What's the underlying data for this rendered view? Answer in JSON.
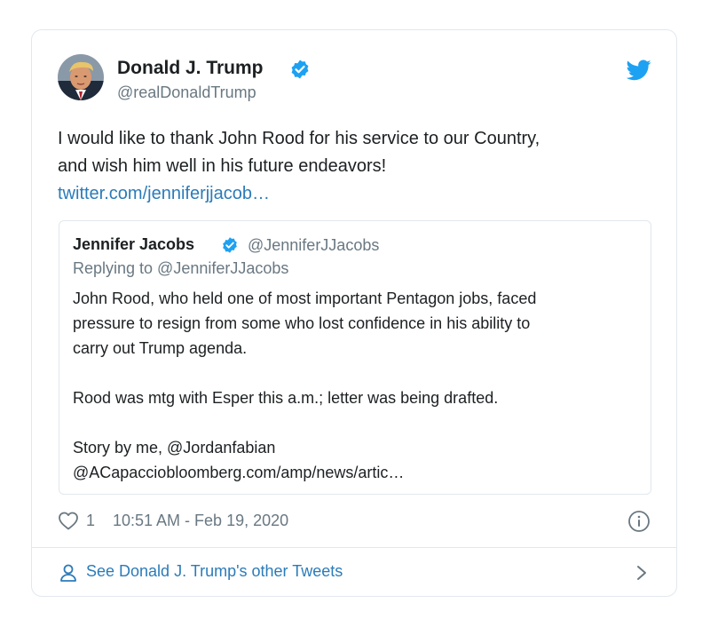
{
  "author": {
    "name": "Donald J. Trump",
    "handle": "@realDonaldTrump"
  },
  "tweet": {
    "text_lines": [
      "I would like to thank John Rood for his service to our Country,",
      "and wish him well in his future endeavors!"
    ],
    "link_text": "twitter.com/jenniferjjacob…"
  },
  "quote": {
    "name": "Jennifer Jacobs",
    "handle": "@JenniferJJacobs",
    "replying_to": "Replying to @JenniferJJacobs",
    "body_lines": [
      "John Rood, who held one of most important Pentagon jobs, faced",
      "pressure to resign from some who lost confidence in his ability to",
      "carry out Trump agenda.",
      "",
      "Rood was mtg with Esper this a.m.; letter was being drafted.",
      "",
      "Story by me, @Jordanfabian",
      "@ACapacciobloomberg.com/amp/news/artic…"
    ]
  },
  "meta": {
    "likes": "1",
    "timestamp": "10:51 AM - Feb 19, 2020"
  },
  "footer": {
    "label": "See Donald J. Trump's other Tweets"
  },
  "icons": {
    "verified": "verified-badge-icon",
    "twitter": "twitter-bird-icon",
    "like": "heart-icon",
    "info": "info-icon",
    "profile": "person-icon",
    "chevron": "chevron-right-icon"
  },
  "colors": {
    "twitter_blue": "#1da1f2",
    "link": "#2b7bb9",
    "secondary_text": "#697882",
    "primary_text": "#1c2022",
    "border": "#e1e8ed"
  }
}
